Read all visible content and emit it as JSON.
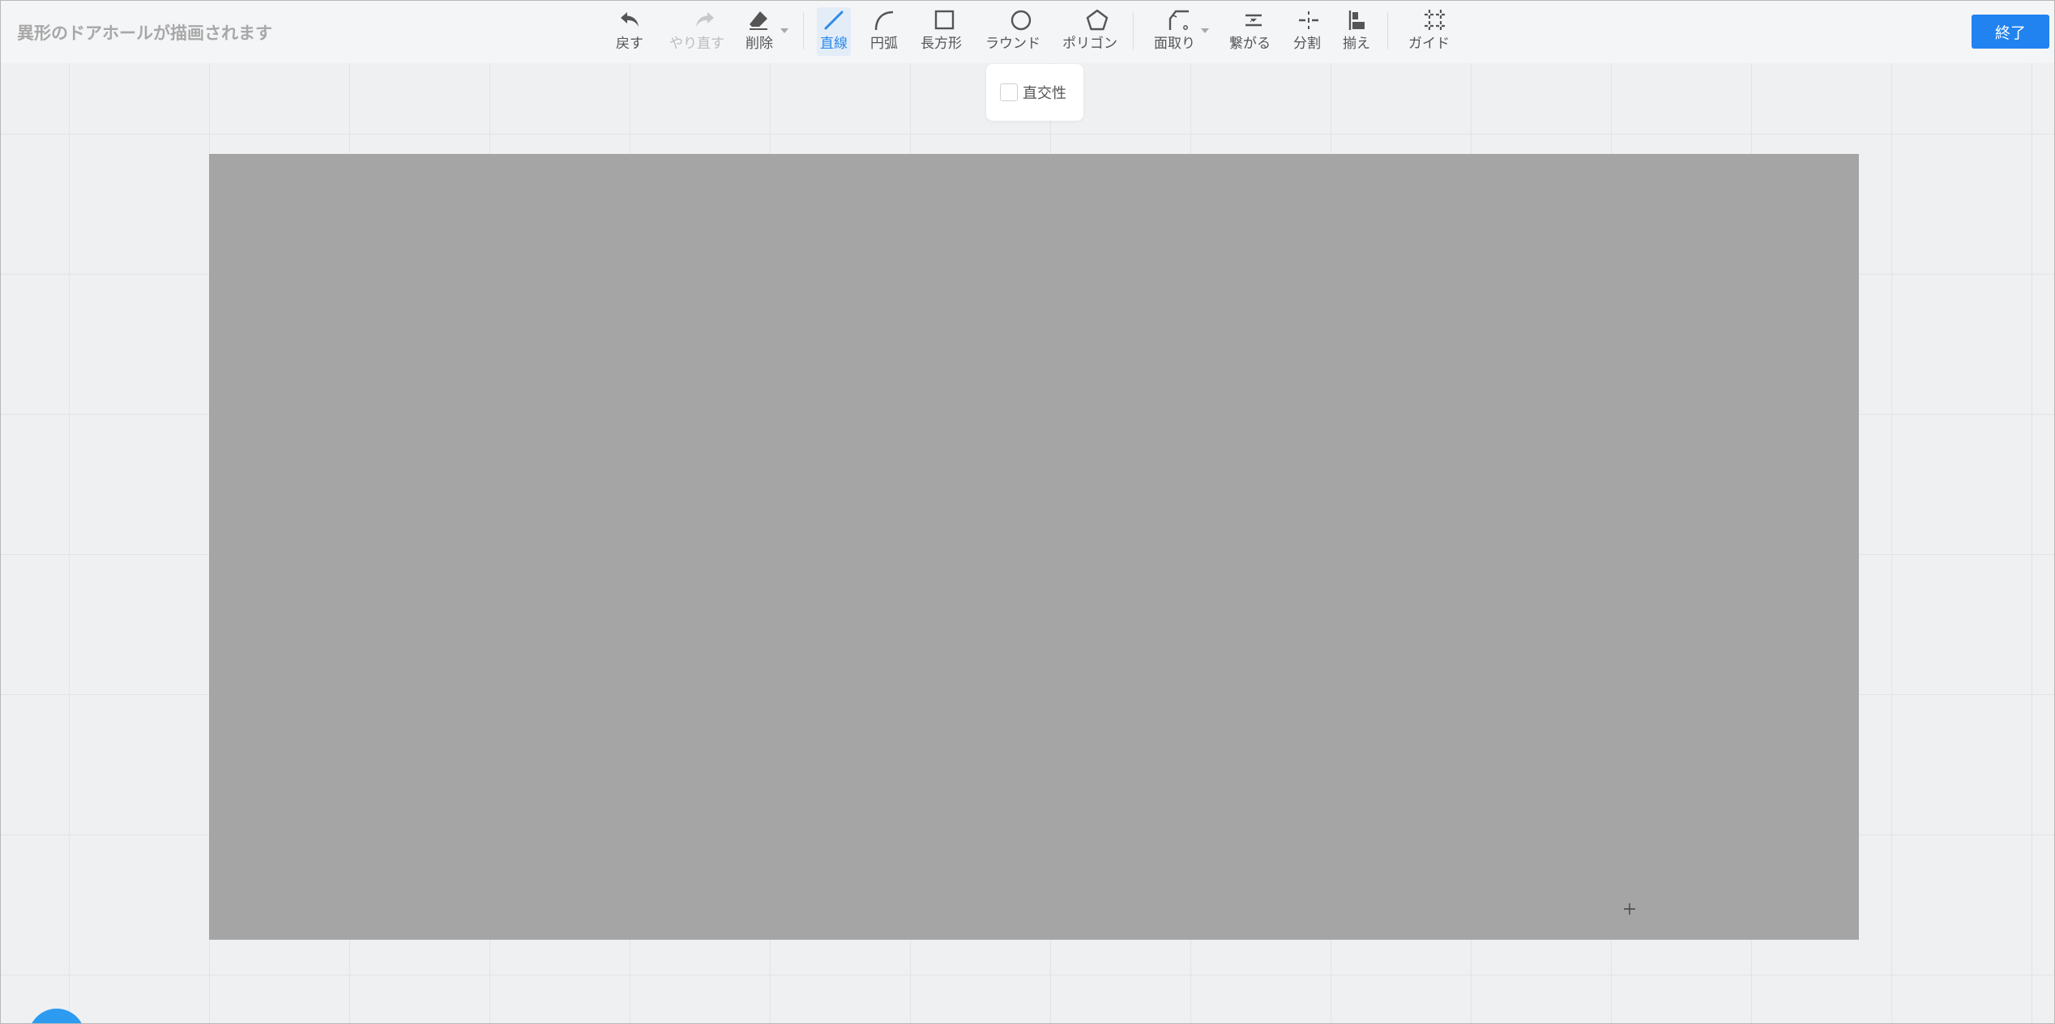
{
  "page": {
    "title": "異形のドアホールが描画されます"
  },
  "toolbar": {
    "undo": "戻す",
    "redo": "やり直す",
    "delete": "削除",
    "line": "直線",
    "arc": "円弧",
    "rectangle": "長方形",
    "round": "ラウンド",
    "polygon": "ポリゴン",
    "chamfer": "面取り",
    "connect": "繋がる",
    "split": "分割",
    "align": "揃え",
    "guide": "ガイド"
  },
  "finish_button": "終了",
  "line_options": {
    "orthogonal_label": "直交性",
    "orthogonal_checked": false
  },
  "colors": {
    "accent": "#2083f0",
    "active_tool": "#2c8ae8",
    "canvas_fill": "#a5a5a5",
    "background": "#eff0f2"
  },
  "icons": {
    "undo": "undo-arrow-icon",
    "redo": "redo-arrow-icon",
    "delete": "eraser-icon",
    "line": "line-icon",
    "arc": "arc-icon",
    "rectangle": "square-icon",
    "round": "circle-icon",
    "polygon": "pentagon-icon",
    "chamfer": "chamfer-icon",
    "connect": "connect-icon",
    "split": "split-icon",
    "align": "align-icon",
    "guide": "guide-frame-icon"
  }
}
